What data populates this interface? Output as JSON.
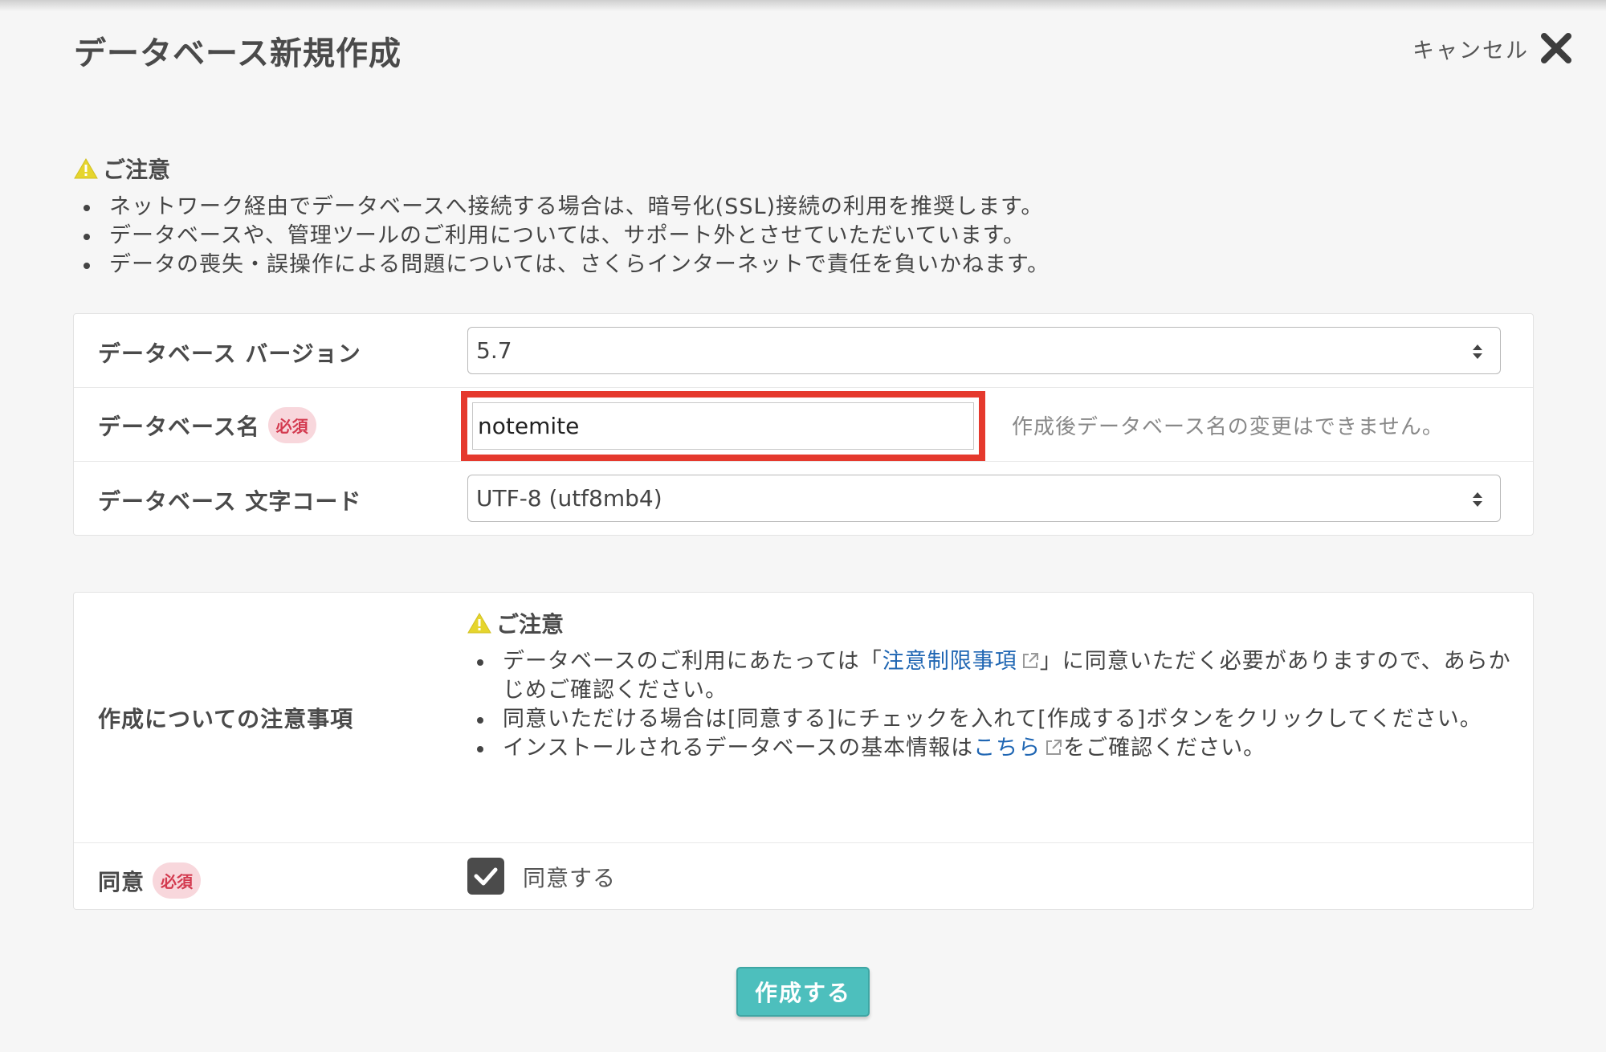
{
  "header": {
    "title": "データベース新規作成",
    "cancel_label": "キャンセル"
  },
  "notice": {
    "heading": "ご注意",
    "items": [
      "ネットワーク経由でデータベースへ接続する場合は、暗号化(SSL)接続の利用を推奨します。",
      "データベースや、管理ツールのご利用については、サポート外とさせていただいています。",
      "データの喪失・誤操作による問題については、さくらインターネットで責任を負いかねます。"
    ]
  },
  "form": {
    "required_badge": "必須",
    "version": {
      "label": "データベース バージョン",
      "value": "5.7"
    },
    "name": {
      "label": "データベース名",
      "value": "notemite",
      "note": "作成後データベース名の変更はできません。"
    },
    "charset": {
      "label": "データベース 文字コード",
      "value": "UTF-8 (utf8mb4)"
    }
  },
  "terms": {
    "label": "作成についての注意事項",
    "heading": "ご注意",
    "item1_before": "データベースのご利用にあたっては「",
    "item1_link": "注意制限事項",
    "item1_after": "」に同意いただく必要がありますので、あらかじめご確認ください。",
    "item2": "同意いただける場合は[同意する]にチェックを入れて[作成する]ボタンをクリックしてください。",
    "item3_before": "インストールされるデータベースの基本情報は",
    "item3_link": "こちら",
    "item3_after": "をご確認ください。"
  },
  "agreement": {
    "label": "同意",
    "checkbox_label": "同意する",
    "checked": true
  },
  "submit_label": "作成する",
  "colors": {
    "accent": "#4dbfbd",
    "highlight": "#e5392d",
    "required": "#d33a4f",
    "link": "#1f66b3",
    "warning": "#e6d52d"
  }
}
